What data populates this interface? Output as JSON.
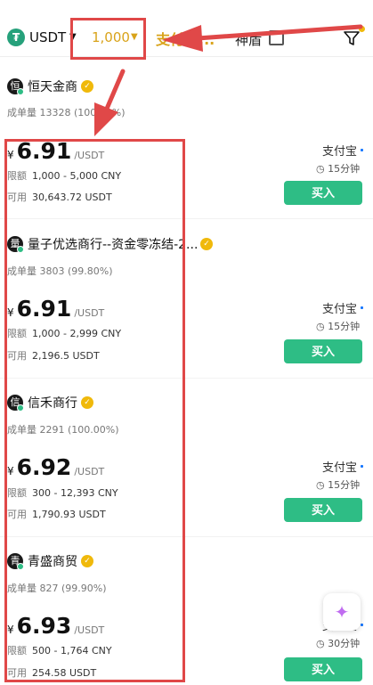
{
  "header": {
    "coin_icon": "tether-icon",
    "coin_symbol": "₮",
    "coin": "USDT",
    "amount": "1,000",
    "pay_tab": "支付宝...",
    "shield_label": "神盾",
    "caret": "▼"
  },
  "merchants": [
    {
      "initial": "恒",
      "name": "恒天金商",
      "stats": "成单量 13328 (100.00%)",
      "currency": "¥",
      "price": "6.91",
      "unit": "/USDT",
      "limit_label": "限额",
      "limit": "1,000 - 5,000 CNY",
      "avail_label": "可用",
      "avail": "30,643.72 USDT",
      "pay_method": "支付宝",
      "time": "15分钟",
      "buy": "买入"
    },
    {
      "initial": "量",
      "name": "量子优选商行--资金零冻结-2...",
      "stats": "成单量 3803 (99.80%)",
      "currency": "¥",
      "price": "6.91",
      "unit": "/USDT",
      "limit_label": "限额",
      "limit": "1,000 - 2,999 CNY",
      "avail_label": "可用",
      "avail": "2,196.5 USDT",
      "pay_method": "支付宝",
      "time": "15分钟",
      "buy": "买入"
    },
    {
      "initial": "信",
      "name": "信禾商行",
      "stats": "成单量 2291 (100.00%)",
      "currency": "¥",
      "price": "6.92",
      "unit": "/USDT",
      "limit_label": "限额",
      "limit": "300 - 12,393 CNY",
      "avail_label": "可用",
      "avail": "1,790.93 USDT",
      "pay_method": "支付宝",
      "time": "15分钟",
      "buy": "买入"
    },
    {
      "initial": "青",
      "name": "青盛商贸",
      "stats": "成单量 827 (99.90%)",
      "currency": "¥",
      "price": "6.93",
      "unit": "/USDT",
      "limit_label": "限额",
      "limit": "500 - 1,764 CNY",
      "avail_label": "可用",
      "avail": "254.58 USDT",
      "pay_method": "支付宝",
      "time": "30分钟",
      "buy": "买入"
    }
  ],
  "icons": {
    "verify": "verified-badge-icon",
    "clock": "clock-icon",
    "filter": "filter-icon",
    "fab": "sparkle-icon"
  },
  "colors": {
    "accent_gold": "#d9a31a",
    "buy_green": "#2ebd85",
    "annotation_red": "#e04848"
  }
}
